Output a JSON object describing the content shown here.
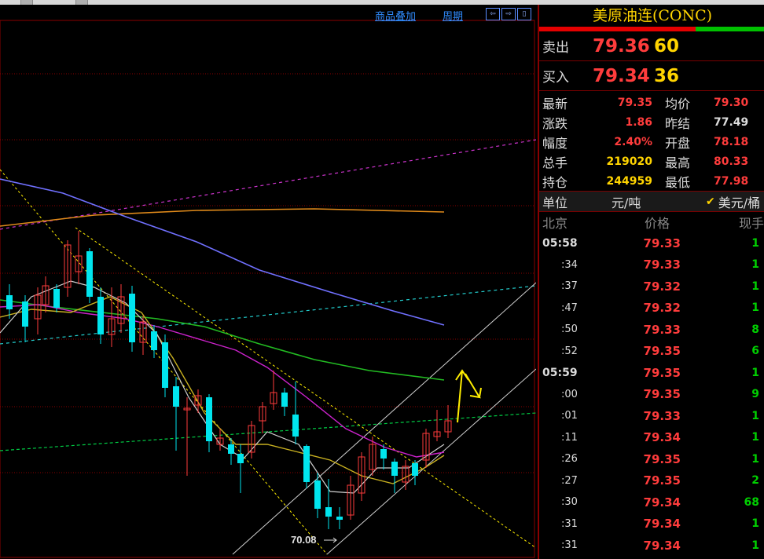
{
  "toolbar": {
    "overlay_label": "商品叠加",
    "period_label": "周期",
    "nav_buttons": [
      "⇦",
      "⇨",
      "▯"
    ]
  },
  "chart": {
    "low_annotation": "70.08",
    "colors": {
      "up_candle": "#ff3c3c",
      "down_candle": "#00e5ee",
      "grid": "#8a0000"
    }
  },
  "quote": {
    "title": "美原油连(CONC)",
    "sell_label": "卖出",
    "sell_price": "79.36",
    "sell_vol": "60",
    "buy_label": "买入",
    "buy_price": "79.34",
    "buy_vol": "36",
    "rows": [
      {
        "k": "最新",
        "v": "79.35",
        "vc": "#ff3c3c",
        "k2": "均价",
        "v2": "79.30",
        "v2c": "#ff3c3c"
      },
      {
        "k": "涨跌",
        "v": "1.86",
        "vc": "#ff3c3c",
        "k2": "昨结",
        "v2": "77.49",
        "v2c": "#dddddd"
      },
      {
        "k": "幅度",
        "v": "2.40%",
        "vc": "#ff3c3c",
        "k2": "开盘",
        "v2": "78.18",
        "v2c": "#ff3c3c"
      },
      {
        "k": "总手",
        "v": "219020",
        "vc": "#ffd400",
        "k2": "最高",
        "v2": "80.33",
        "v2c": "#ff3c3c"
      },
      {
        "k": "持仓",
        "v": "244959",
        "vc": "#ffd400",
        "k2": "最低",
        "v2": "77.98",
        "v2c": "#ff3c3c"
      }
    ],
    "unit_label": "单位",
    "unit_value": "元/吨",
    "unit_alt": "美元/桶",
    "table_header": {
      "time": "北京",
      "price": "价格",
      "qty": "现手"
    },
    "ticks": [
      {
        "t": "05:58",
        "sub": false,
        "p": "79.33",
        "q": "1"
      },
      {
        "t": ":34",
        "sub": true,
        "p": "79.33",
        "q": "1"
      },
      {
        "t": ":37",
        "sub": true,
        "p": "79.32",
        "q": "1"
      },
      {
        "t": ":47",
        "sub": true,
        "p": "79.32",
        "q": "1"
      },
      {
        "t": ":50",
        "sub": true,
        "p": "79.33",
        "q": "8"
      },
      {
        "t": ":52",
        "sub": true,
        "p": "79.35",
        "q": "6"
      },
      {
        "t": "05:59",
        "sub": false,
        "p": "79.35",
        "q": "1"
      },
      {
        "t": ":00",
        "sub": true,
        "p": "79.35",
        "q": "9"
      },
      {
        "t": ":01",
        "sub": true,
        "p": "79.33",
        "q": "1"
      },
      {
        "t": ":11",
        "sub": true,
        "p": "79.34",
        "q": "1"
      },
      {
        "t": ":26",
        "sub": true,
        "p": "79.35",
        "q": "1"
      },
      {
        "t": ":27",
        "sub": true,
        "p": "79.35",
        "q": "2"
      },
      {
        "t": ":30",
        "sub": true,
        "p": "79.34",
        "q": "68"
      },
      {
        "t": ":31",
        "sub": true,
        "p": "79.34",
        "q": "1"
      },
      {
        "t": ":31",
        "sub": true,
        "p": "79.34",
        "q": "1"
      }
    ]
  }
}
